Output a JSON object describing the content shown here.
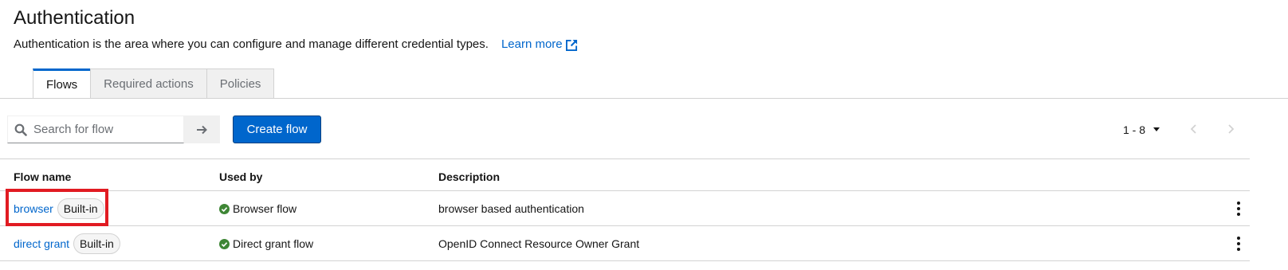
{
  "header": {
    "title": "Authentication",
    "description": "Authentication is the area where you can configure and manage different credential types.",
    "learn_more": "Learn more"
  },
  "tabs": [
    {
      "label": "Flows",
      "active": true
    },
    {
      "label": "Required actions",
      "active": false
    },
    {
      "label": "Policies",
      "active": false
    }
  ],
  "toolbar": {
    "search_placeholder": "Search for flow",
    "create_label": "Create flow",
    "pagination_range": "1 - 8"
  },
  "table": {
    "columns": [
      "Flow name",
      "Used by",
      "Description"
    ],
    "rows": [
      {
        "name": "browser",
        "badge": "Built-in",
        "used_by": "Browser flow",
        "description": "browser based authentication"
      },
      {
        "name": "direct grant",
        "badge": "Built-in",
        "used_by": "Direct grant flow",
        "description": "OpenID Connect Resource Owner Grant"
      }
    ]
  },
  "colors": {
    "accent": "#0066cc",
    "success": "#3e8635",
    "highlight": "#e11b22"
  },
  "icons": {
    "learn_more": "external-link-icon",
    "search": "search-icon",
    "search_go": "arrow-right-icon",
    "used_by": "check-circle-icon",
    "row_actions": "kebab-icon"
  }
}
